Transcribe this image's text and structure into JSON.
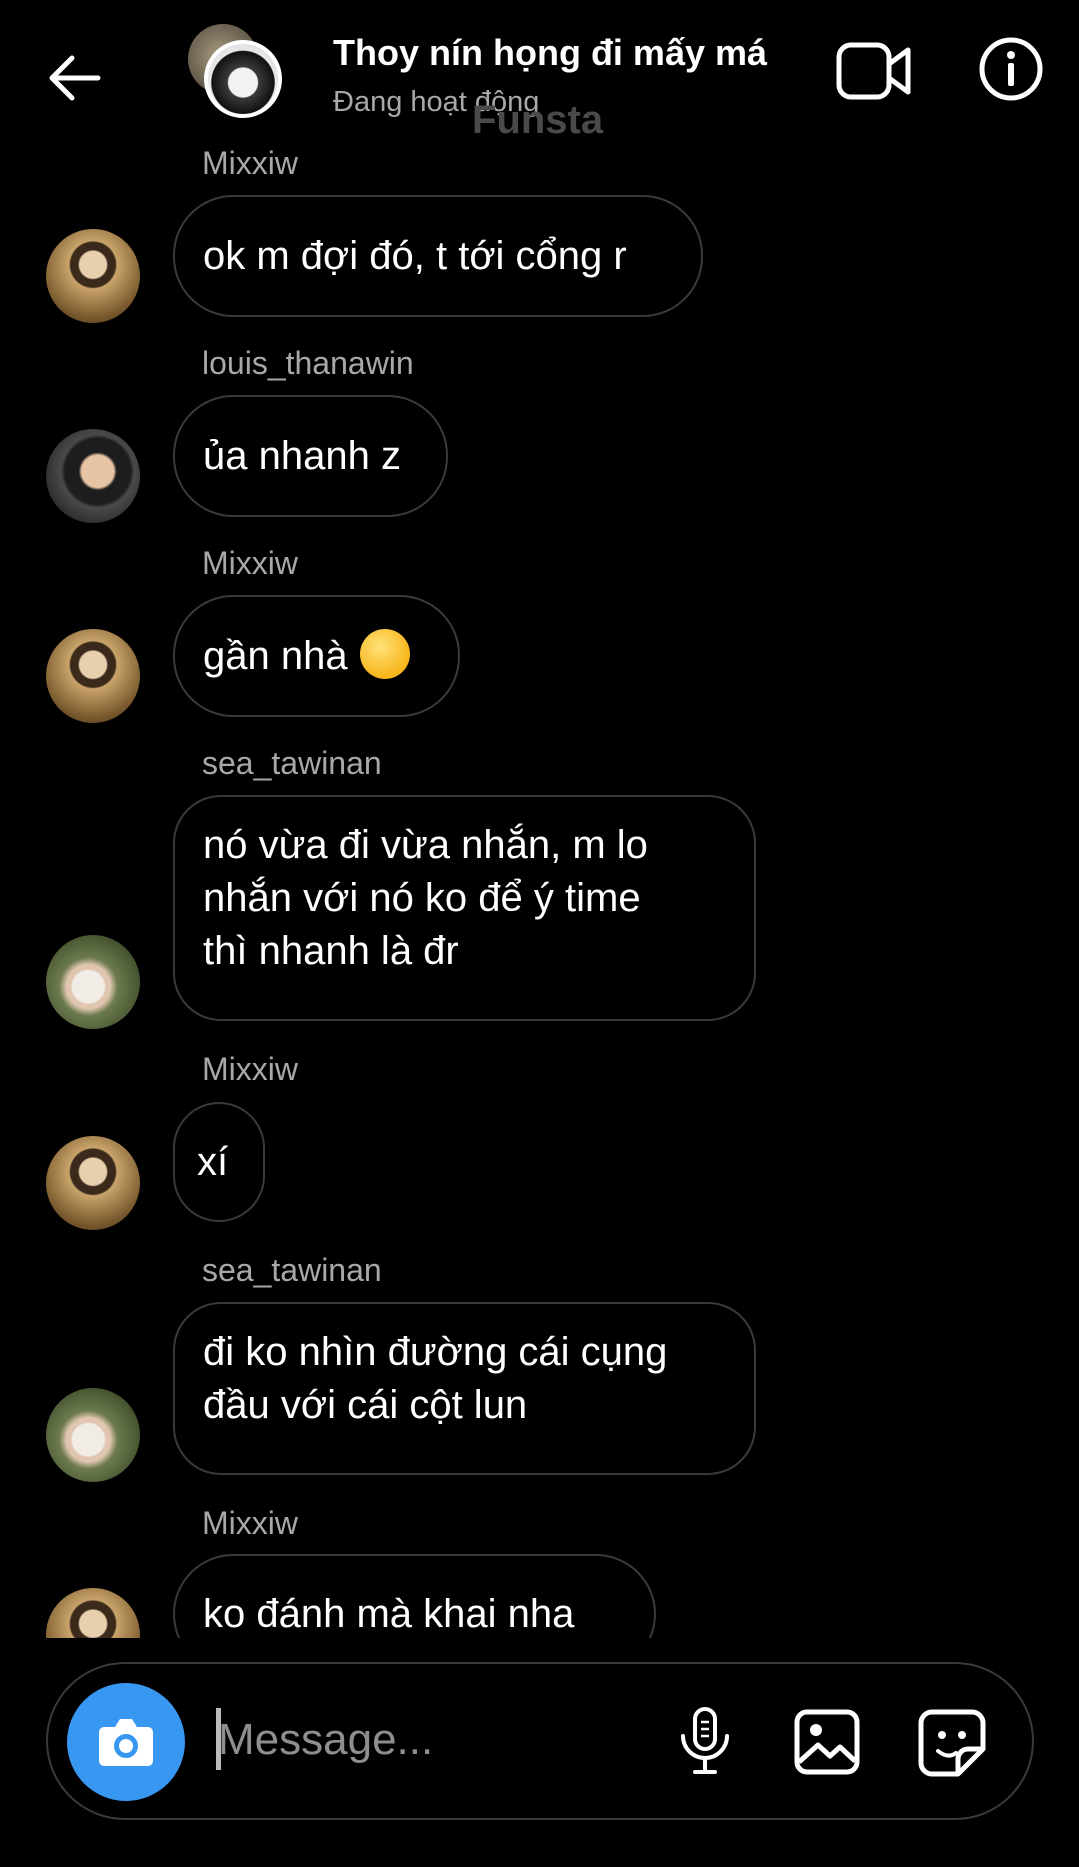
{
  "header": {
    "title": "Thoy nín họng đi mấy má",
    "status": "Đang hoạt động",
    "watermark": "Funsta"
  },
  "messages": [
    {
      "sender": "Mixxiw",
      "text": "ok m đợi đó, t tới cổng r"
    },
    {
      "sender": "louis_thanawin",
      "text": "ủa nhanh z"
    },
    {
      "sender": "Mixxiw",
      "text": "gần nhà",
      "emoji": "winking-face"
    },
    {
      "sender": "sea_tawinan",
      "text": "nó vừa đi vừa nhắn, m lo\nnhắn với nó ko để ý time\nthì nhanh là đr"
    },
    {
      "sender": "Mixxiw",
      "text": "xí"
    },
    {
      "sender": "sea_tawinan",
      "text": "đi ko nhìn đường cái cụng\nđầu với cái cột lun"
    },
    {
      "sender": "Mixxiw",
      "text": "ko đánh mà khai nha"
    }
  ],
  "composer": {
    "placeholder": "Message..."
  },
  "colors": {
    "background": "#000000",
    "bubble_border": "#3a3a3a",
    "secondary_text": "#a8a8a8",
    "camera_button": "#3897f0"
  },
  "icons": [
    "back-arrow-icon",
    "video-camera-icon",
    "info-icon",
    "camera-icon",
    "microphone-icon",
    "gallery-icon",
    "sticker-icon"
  ]
}
